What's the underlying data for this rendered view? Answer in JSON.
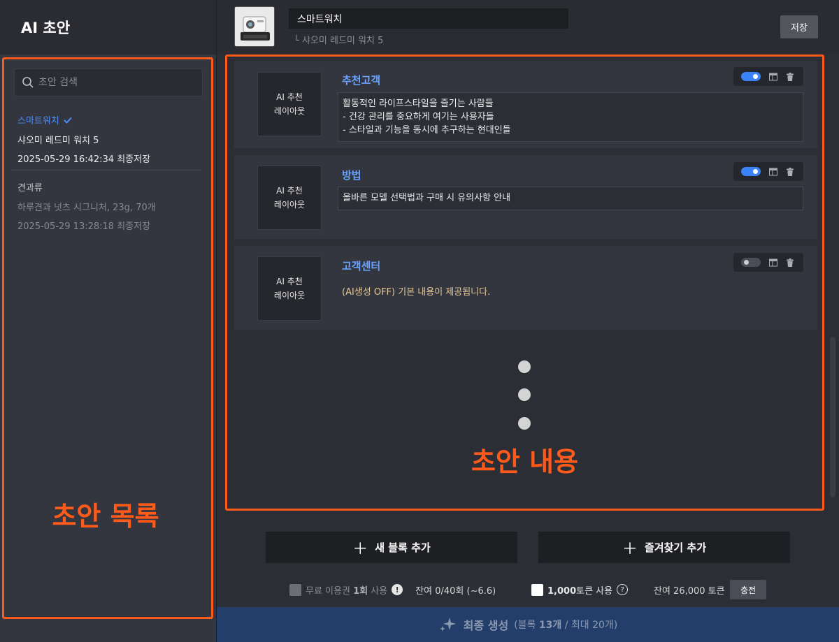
{
  "sidebar": {
    "title": "AI 초안",
    "search_placeholder": "초안 검색",
    "drafts": [
      {
        "category": "스마트워치",
        "name": "샤오미 레드미 워치 5",
        "saved": "2025-05-29 16:42:34 최종저장",
        "selected": true
      },
      {
        "category": "견과류",
        "name": "하루견과 넛츠 시그니처, 23g, 70개",
        "saved": "2025-05-29 13:28:18 최종저장",
        "selected": false
      }
    ],
    "overlay_label": "초안 목록"
  },
  "header": {
    "title_value": "스마트워치",
    "subtitle": "샤오미 레드미 워치 5",
    "save_label": "저장"
  },
  "blocks": [
    {
      "thumb_label_1": "AI 추천",
      "thumb_label_2": "레이아웃",
      "title": "추천고객",
      "text": "활동적인 라이프스타일을 즐기는 사람들\n- 건강 관리를 중요하게 여기는 사용자들\n- 스타일과 기능을 동시에 추구하는 현대인들",
      "ai_enabled": true
    },
    {
      "thumb_label_1": "AI 추천",
      "thumb_label_2": "레이아웃",
      "title": "방법",
      "text": "올바른 모델 선택법과 구매 시 유의사항 안내",
      "ai_enabled": true
    },
    {
      "thumb_label_1": "AI 추천",
      "thumb_label_2": "레이아웃",
      "title": "고객센터",
      "note": "(AI생성 OFF) 기본 내용이 제공됩니다.",
      "ai_enabled": false
    }
  ],
  "content_overlay_label": "초안 내용",
  "actions": {
    "add_block_label": "새 블록 추가",
    "add_favorite_label": "즐겨찾기 추가"
  },
  "footer": {
    "free_pass_prefix": "무료 이용권 ",
    "free_pass_count": "1회",
    "free_pass_suffix": " 사용",
    "free_remaining": "잔여 0/40회 (~6.6)",
    "token_amount": "1,000",
    "token_suffix": "토큰 사용",
    "token_remaining": "잔여 26,000 토큰",
    "charge_label": "충전"
  },
  "generate": {
    "label": "최종 생성",
    "sub_prefix": "(블록 ",
    "block_count": "13개",
    "sub_suffix": " / 최대 20개)"
  },
  "colors": {
    "accent_orange": "#ff5a1a",
    "link_blue": "#6aa3ff",
    "toggle_on": "#3b82f6",
    "generate_bg": "#233e6a"
  }
}
